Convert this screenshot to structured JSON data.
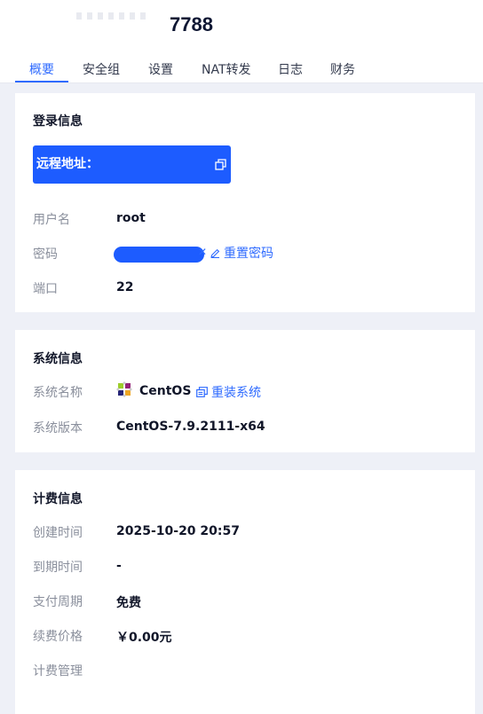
{
  "header": {
    "title": "7788"
  },
  "tabs": [
    {
      "label": "概要",
      "active": true
    },
    {
      "label": "安全组"
    },
    {
      "label": "设置"
    },
    {
      "label": "NAT转发"
    },
    {
      "label": "日志"
    },
    {
      "label": "财务"
    }
  ],
  "login": {
    "title": "登录信息",
    "remote_label": "远程地址：",
    "username_label": "用户名",
    "username": "root",
    "password_label": "密码",
    "reset_password": "重置密码",
    "port_label": "端口",
    "port": "22"
  },
  "system": {
    "title": "系统信息",
    "name_label": "系统名称",
    "name": "CentOS",
    "reinstall": "重装系统",
    "version_label": "系统版本",
    "version": "CentOS-7.9.2111-x64"
  },
  "billing": {
    "title": "计费信息",
    "created_label": "创建时间",
    "created": "2025-10-20 20:57",
    "expire_label": "到期时间",
    "expire": "-",
    "cycle_label": "支付周期",
    "cycle": "免费",
    "price_label": "续费价格",
    "price": "￥0.00元",
    "manage_label": "计费管理"
  },
  "colors": {
    "accent": "#2f6bff",
    "remote_box": "#1d5cff",
    "background": "#eef0f7"
  }
}
